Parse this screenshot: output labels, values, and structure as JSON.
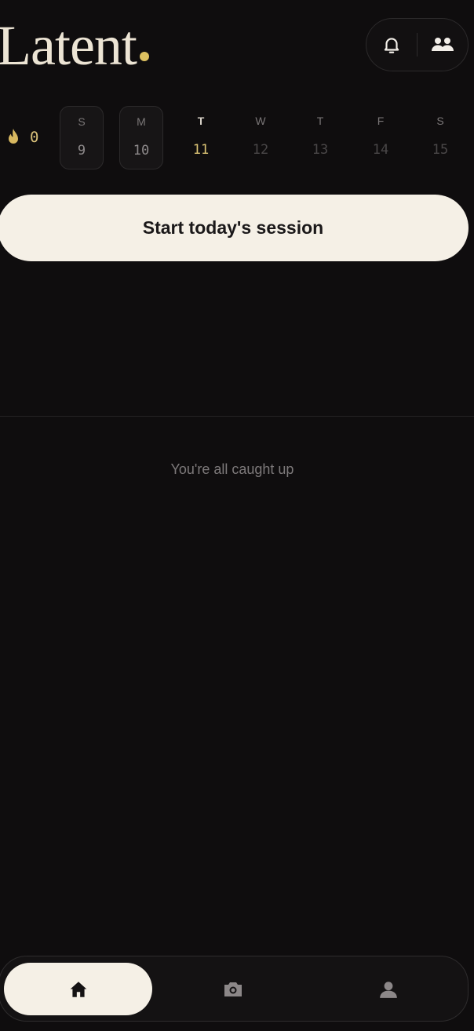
{
  "app": {
    "logo_text": "Latent",
    "accent_color": "#dcc060",
    "background_color": "#0f0d0e"
  },
  "header": {
    "notifications_icon": "bell-icon",
    "friends_icon": "people-icon"
  },
  "streak": {
    "icon": "flame-icon",
    "count": "0"
  },
  "week": {
    "days": [
      {
        "letter": "S",
        "number": "9",
        "state": "past"
      },
      {
        "letter": "M",
        "number": "10",
        "state": "past"
      },
      {
        "letter": "T",
        "number": "11",
        "state": "today"
      },
      {
        "letter": "W",
        "number": "12",
        "state": "future"
      },
      {
        "letter": "T",
        "number": "13",
        "state": "future"
      },
      {
        "letter": "F",
        "number": "14",
        "state": "future"
      },
      {
        "letter": "S",
        "number": "15",
        "state": "future"
      }
    ]
  },
  "cta": {
    "label": "Start today's session"
  },
  "feed": {
    "empty_text": "You're all caught up"
  },
  "nav": {
    "items": [
      {
        "icon": "home-icon",
        "active": true
      },
      {
        "icon": "camera-icon",
        "active": false
      },
      {
        "icon": "profile-icon",
        "active": false
      }
    ]
  }
}
